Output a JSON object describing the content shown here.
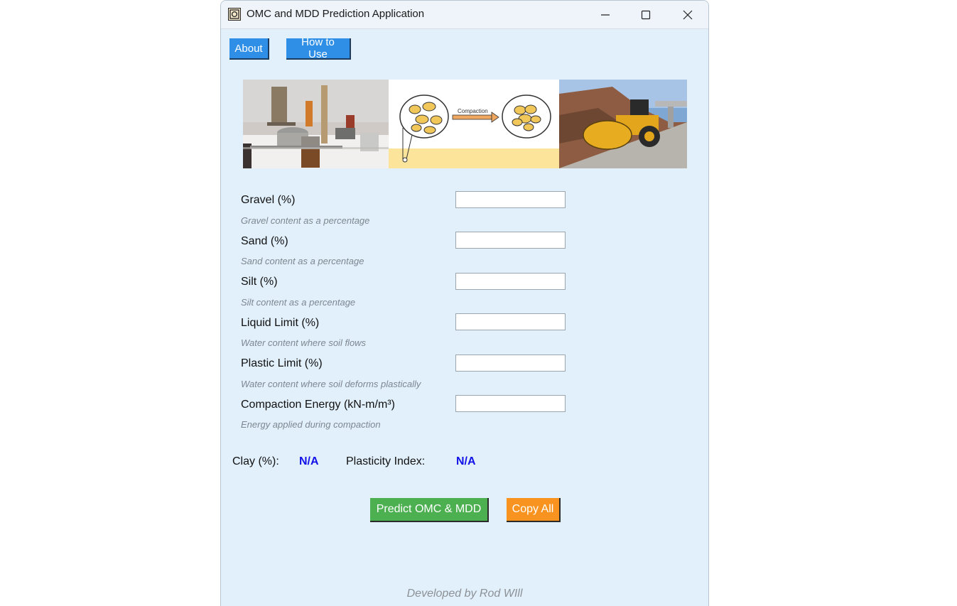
{
  "window": {
    "title": "OMC and MDD Prediction Application"
  },
  "nav": {
    "about_label": "About",
    "howto_label": "How to Use"
  },
  "banner": {
    "compaction_label": "Compaction"
  },
  "fields": [
    {
      "label": "Gravel (%)",
      "hint": "Gravel content as a percentage",
      "value": ""
    },
    {
      "label": "Sand (%)",
      "hint": "Sand content as a percentage",
      "value": ""
    },
    {
      "label": "Silt (%)",
      "hint": "Silt content as a percentage",
      "value": ""
    },
    {
      "label": "Liquid Limit (%)",
      "hint": "Water content where soil flows",
      "value": ""
    },
    {
      "label": "Plastic Limit (%)",
      "hint": "Water content where soil deforms plastically",
      "value": ""
    },
    {
      "label": "Compaction Energy (kN-m/m³)",
      "hint": "Energy applied during compaction",
      "value": ""
    }
  ],
  "calculated": {
    "clay_label": "Clay (%):",
    "clay_value": "N/A",
    "pi_label": "Plasticity Index:",
    "pi_value": "N/A"
  },
  "actions": {
    "predict_label": "Predict OMC & MDD",
    "copy_label": "Copy All"
  },
  "footer": {
    "text": "Developed by Rod WIll"
  },
  "colors": {
    "nav_button": "#2f8fe6",
    "predict_button": "#4caf50",
    "copy_button": "#f7931e",
    "value_text": "#1212e8",
    "window_bg": "#e2f0fb"
  }
}
